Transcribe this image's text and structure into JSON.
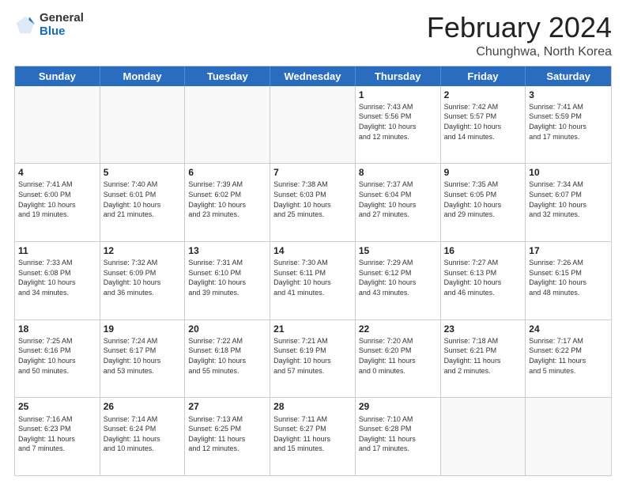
{
  "header": {
    "logo_general": "General",
    "logo_blue": "Blue",
    "main_title": "February 2024",
    "subtitle": "Chunghwa, North Korea"
  },
  "calendar": {
    "days_of_week": [
      "Sunday",
      "Monday",
      "Tuesday",
      "Wednesday",
      "Thursday",
      "Friday",
      "Saturday"
    ],
    "rows": [
      [
        {
          "day": "",
          "info": "",
          "empty": true
        },
        {
          "day": "",
          "info": "",
          "empty": true
        },
        {
          "day": "",
          "info": "",
          "empty": true
        },
        {
          "day": "",
          "info": "",
          "empty": true
        },
        {
          "day": "1",
          "info": "Sunrise: 7:43 AM\nSunset: 5:56 PM\nDaylight: 10 hours\nand 12 minutes.",
          "empty": false
        },
        {
          "day": "2",
          "info": "Sunrise: 7:42 AM\nSunset: 5:57 PM\nDaylight: 10 hours\nand 14 minutes.",
          "empty": false
        },
        {
          "day": "3",
          "info": "Sunrise: 7:41 AM\nSunset: 5:59 PM\nDaylight: 10 hours\nand 17 minutes.",
          "empty": false
        }
      ],
      [
        {
          "day": "4",
          "info": "Sunrise: 7:41 AM\nSunset: 6:00 PM\nDaylight: 10 hours\nand 19 minutes.",
          "empty": false
        },
        {
          "day": "5",
          "info": "Sunrise: 7:40 AM\nSunset: 6:01 PM\nDaylight: 10 hours\nand 21 minutes.",
          "empty": false
        },
        {
          "day": "6",
          "info": "Sunrise: 7:39 AM\nSunset: 6:02 PM\nDaylight: 10 hours\nand 23 minutes.",
          "empty": false
        },
        {
          "day": "7",
          "info": "Sunrise: 7:38 AM\nSunset: 6:03 PM\nDaylight: 10 hours\nand 25 minutes.",
          "empty": false
        },
        {
          "day": "8",
          "info": "Sunrise: 7:37 AM\nSunset: 6:04 PM\nDaylight: 10 hours\nand 27 minutes.",
          "empty": false
        },
        {
          "day": "9",
          "info": "Sunrise: 7:35 AM\nSunset: 6:05 PM\nDaylight: 10 hours\nand 29 minutes.",
          "empty": false
        },
        {
          "day": "10",
          "info": "Sunrise: 7:34 AM\nSunset: 6:07 PM\nDaylight: 10 hours\nand 32 minutes.",
          "empty": false
        }
      ],
      [
        {
          "day": "11",
          "info": "Sunrise: 7:33 AM\nSunset: 6:08 PM\nDaylight: 10 hours\nand 34 minutes.",
          "empty": false
        },
        {
          "day": "12",
          "info": "Sunrise: 7:32 AM\nSunset: 6:09 PM\nDaylight: 10 hours\nand 36 minutes.",
          "empty": false
        },
        {
          "day": "13",
          "info": "Sunrise: 7:31 AM\nSunset: 6:10 PM\nDaylight: 10 hours\nand 39 minutes.",
          "empty": false
        },
        {
          "day": "14",
          "info": "Sunrise: 7:30 AM\nSunset: 6:11 PM\nDaylight: 10 hours\nand 41 minutes.",
          "empty": false
        },
        {
          "day": "15",
          "info": "Sunrise: 7:29 AM\nSunset: 6:12 PM\nDaylight: 10 hours\nand 43 minutes.",
          "empty": false
        },
        {
          "day": "16",
          "info": "Sunrise: 7:27 AM\nSunset: 6:13 PM\nDaylight: 10 hours\nand 46 minutes.",
          "empty": false
        },
        {
          "day": "17",
          "info": "Sunrise: 7:26 AM\nSunset: 6:15 PM\nDaylight: 10 hours\nand 48 minutes.",
          "empty": false
        }
      ],
      [
        {
          "day": "18",
          "info": "Sunrise: 7:25 AM\nSunset: 6:16 PM\nDaylight: 10 hours\nand 50 minutes.",
          "empty": false
        },
        {
          "day": "19",
          "info": "Sunrise: 7:24 AM\nSunset: 6:17 PM\nDaylight: 10 hours\nand 53 minutes.",
          "empty": false
        },
        {
          "day": "20",
          "info": "Sunrise: 7:22 AM\nSunset: 6:18 PM\nDaylight: 10 hours\nand 55 minutes.",
          "empty": false
        },
        {
          "day": "21",
          "info": "Sunrise: 7:21 AM\nSunset: 6:19 PM\nDaylight: 10 hours\nand 57 minutes.",
          "empty": false
        },
        {
          "day": "22",
          "info": "Sunrise: 7:20 AM\nSunset: 6:20 PM\nDaylight: 11 hours\nand 0 minutes.",
          "empty": false
        },
        {
          "day": "23",
          "info": "Sunrise: 7:18 AM\nSunset: 6:21 PM\nDaylight: 11 hours\nand 2 minutes.",
          "empty": false
        },
        {
          "day": "24",
          "info": "Sunrise: 7:17 AM\nSunset: 6:22 PM\nDaylight: 11 hours\nand 5 minutes.",
          "empty": false
        }
      ],
      [
        {
          "day": "25",
          "info": "Sunrise: 7:16 AM\nSunset: 6:23 PM\nDaylight: 11 hours\nand 7 minutes.",
          "empty": false
        },
        {
          "day": "26",
          "info": "Sunrise: 7:14 AM\nSunset: 6:24 PM\nDaylight: 11 hours\nand 10 minutes.",
          "empty": false
        },
        {
          "day": "27",
          "info": "Sunrise: 7:13 AM\nSunset: 6:25 PM\nDaylight: 11 hours\nand 12 minutes.",
          "empty": false
        },
        {
          "day": "28",
          "info": "Sunrise: 7:11 AM\nSunset: 6:27 PM\nDaylight: 11 hours\nand 15 minutes.",
          "empty": false
        },
        {
          "day": "29",
          "info": "Sunrise: 7:10 AM\nSunset: 6:28 PM\nDaylight: 11 hours\nand 17 minutes.",
          "empty": false
        },
        {
          "day": "",
          "info": "",
          "empty": true
        },
        {
          "day": "",
          "info": "",
          "empty": true
        }
      ]
    ]
  }
}
